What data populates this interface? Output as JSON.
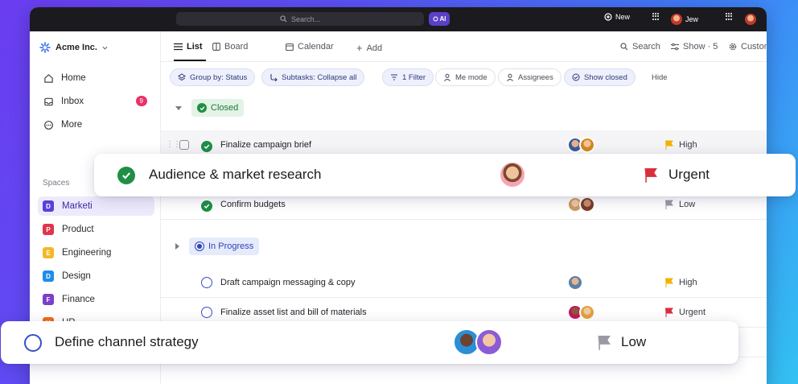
{
  "topbar": {
    "search_placeholder": "Search...",
    "ai_label": "AI",
    "new_label": "New",
    "user_label": "Jew"
  },
  "sidebar": {
    "workspace": "Acme Inc.",
    "nav": [
      {
        "label": "Home",
        "icon": "home-icon"
      },
      {
        "label": "Inbox",
        "icon": "inbox-icon",
        "badge": "9"
      },
      {
        "label": "More",
        "icon": "more-icon"
      }
    ],
    "spaces_label": "Spaces",
    "spaces": [
      {
        "letter": "D",
        "label": "Marketi",
        "color": "#5b3fd6",
        "active": true
      },
      {
        "letter": "P",
        "label": "Product",
        "color": "#e0344f"
      },
      {
        "letter": "E",
        "label": "Engineering",
        "color": "#f4b728"
      },
      {
        "letter": "D",
        "label": "Design",
        "color": "#1f8de8"
      },
      {
        "letter": "F",
        "label": "Finance",
        "color": "#7b3fc9"
      },
      {
        "letter": "H",
        "label": "HR",
        "color": "#f06d1a"
      }
    ]
  },
  "views": {
    "list": "List",
    "board": "Board",
    "calendar": "Calendar",
    "add": "Add",
    "search": "Search",
    "show": "Show · 5",
    "customize": "Customize"
  },
  "chips": {
    "group_by": "Group by: Status",
    "subtasks": "Subtasks: Collapse all",
    "filter": "1 Filter",
    "me_mode": "Me mode",
    "assignees": "Assignees",
    "show_closed": "Show closed",
    "hide": "Hide"
  },
  "groups": {
    "closed": "Closed",
    "in_progress": "In Progress"
  },
  "tasks": [
    {
      "name": "Finalize campaign brief",
      "status": "closed",
      "priority": "High",
      "priority_color": "#f4b100"
    },
    {
      "name": "Confirm budgets",
      "status": "closed",
      "priority": "Low",
      "priority_color": "#9a9aa5"
    },
    {
      "name": "Draft campaign messaging & copy",
      "status": "in_progress",
      "priority": "High",
      "priority_color": "#f4b100"
    },
    {
      "name": "Finalize asset list and bill of materials",
      "status": "in_progress",
      "priority": "Urgent",
      "priority_color": "#d92e3c"
    }
  ],
  "cards": {
    "research": {
      "title": "Audience & market research",
      "priority": "Urgent",
      "priority_color": "#d92e3c"
    },
    "channel": {
      "title": "Define channel strategy",
      "priority": "Low",
      "priority_color": "#9a9aa5"
    }
  },
  "colors": {
    "accent": "#5b3fd6",
    "done": "#1f8f45",
    "in_progress": "#3650c9"
  }
}
